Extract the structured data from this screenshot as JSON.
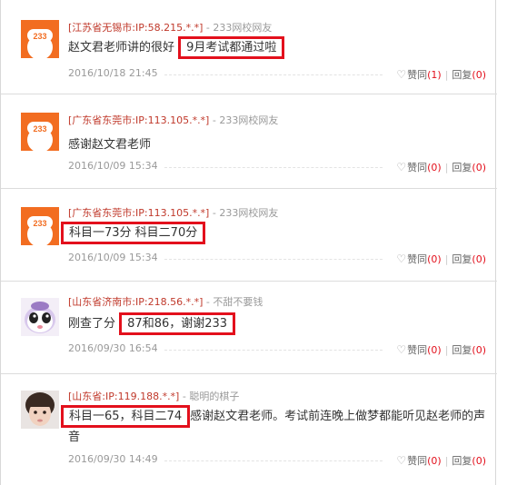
{
  "comments": [
    {
      "location": "[江苏省无锡市:IP:58.215.*.*]",
      "separator": "-",
      "user": "233网校网友",
      "text_plain": "赵文君老师讲的很好",
      "text_highlight": "9月考试都通过啦",
      "text_after": "",
      "date": "2016/10/18 21:45",
      "like_label": "赞同",
      "like_count": "(1)",
      "reply_label": "回复",
      "reply_count": "(0)",
      "avatar": "233-logo-avatar"
    },
    {
      "location": "[广东省东莞市:IP:113.105.*.*]",
      "separator": "-",
      "user": "233网校网友",
      "text_plain": "感谢赵文君老师",
      "date": "2016/10/09 15:34",
      "like_label": "赞同",
      "like_count": "(0)",
      "reply_label": "回复",
      "reply_count": "(0)",
      "avatar": "233-logo-avatar"
    },
    {
      "location": "[广东省东莞市:IP:113.105.*.*]",
      "separator": "-",
      "user": "233网校网友",
      "text_highlight": "科目一73分 科目二70分",
      "date": "2016/10/09 15:34",
      "like_label": "赞同",
      "like_count": "(0)",
      "reply_label": "回复",
      "reply_count": "(0)",
      "avatar": "233-logo-avatar"
    },
    {
      "location": "[山东省济南市:IP:218.56.*.*]",
      "separator": "-",
      "user": "不甜不要钱",
      "text_plain": "刚查了分",
      "text_highlight": "87和86，谢谢233",
      "date": "2016/09/30 16:54",
      "like_label": "赞同",
      "like_count": "(0)",
      "reply_label": "回复",
      "reply_count": "(0)",
      "avatar": "cartoon-face-avatar"
    },
    {
      "location": "[山东省:IP:119.188.*.*]",
      "separator": "-",
      "user": "聪明的棋子",
      "text_highlight": "科目一65，科目二74",
      "text_after": "感谢赵文君老师。考试前连晚上做梦都能听见赵老师的声",
      "text_line2": "音",
      "date": "2016/09/30 14:49",
      "like_label": "赞同",
      "like_count": "(0)",
      "reply_label": "回复",
      "reply_count": "(0)",
      "avatar": "child-photo-avatar"
    }
  ],
  "colors": {
    "highlight_border": "#e3101c",
    "location_text": "#c0392b",
    "brand_orange": "#f26d21"
  }
}
